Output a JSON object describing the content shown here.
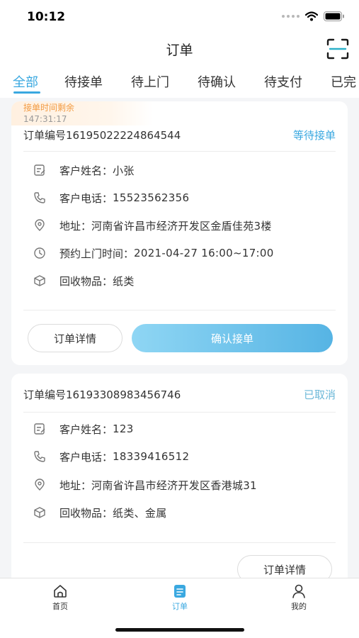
{
  "status_bar": {
    "time": "10:12"
  },
  "header": {
    "title": "订单"
  },
  "tabs": [
    {
      "label": "全部",
      "active": true
    },
    {
      "label": "待接单",
      "active": false
    },
    {
      "label": "待上门",
      "active": false
    },
    {
      "label": "待确认",
      "active": false
    },
    {
      "label": "待支付",
      "active": false
    },
    {
      "label": "已完",
      "active": false
    }
  ],
  "orders": [
    {
      "countdown_label": "接单时间剩余",
      "countdown_time": "147:31:17",
      "order_no": "订单编号16195022224864544",
      "status": "等待接单",
      "customer_name_label": "客户姓名：",
      "customer_name": "小张",
      "phone_label": "客户电话：",
      "phone": "15523562356",
      "address_label": "地址：",
      "address": "河南省许昌市经济开发区金盾佳苑3楼",
      "appointment_label": "预约上门时间：",
      "appointment": "2021-04-27 16:00~17:00",
      "items_label": "回收物品：",
      "items": "纸类",
      "detail_button": "订单详情",
      "confirm_button": "确认接单"
    },
    {
      "order_no": "订单编号16193308983456746",
      "status": "已取消",
      "customer_name_label": "客户姓名：",
      "customer_name": "123",
      "phone_label": "客户电话：",
      "phone": "18339416512",
      "address_label": "地址：",
      "address": "河南省许昌市经济开发区香港城31",
      "items_label": "回收物品：",
      "items": "纸类、金属",
      "detail_button": "订单详情"
    }
  ],
  "tabbar": [
    {
      "label": "首页",
      "icon": "home-icon",
      "active": false
    },
    {
      "label": "订单",
      "icon": "order-list-icon",
      "active": true
    },
    {
      "label": "我的",
      "icon": "user-icon",
      "active": false
    }
  ],
  "colors": {
    "accent": "#3aa8e0",
    "countdown": "#f29b42",
    "cancelled": "#6cb8d8"
  }
}
